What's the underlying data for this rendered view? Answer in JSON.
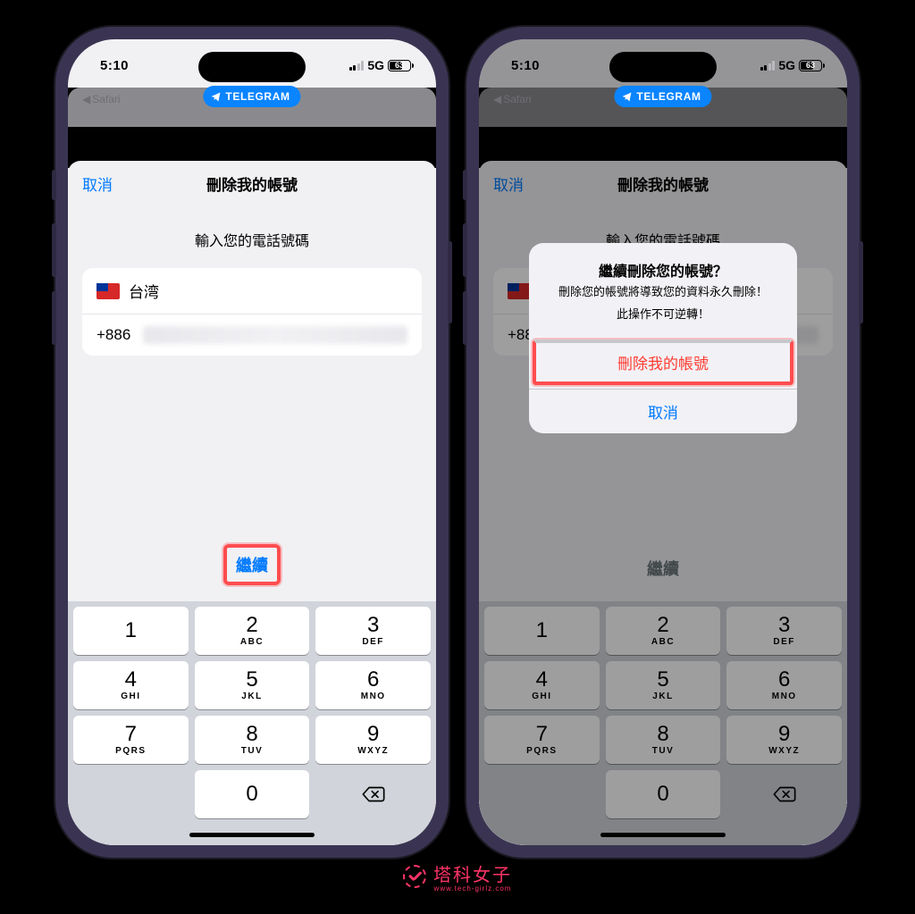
{
  "statusbar": {
    "time": "5:10",
    "back_app": "Safari",
    "pill_label": "TELEGRAM",
    "network": "5G",
    "battery": "63"
  },
  "page": {
    "cancel": "取消",
    "title": "刪除我的帳號",
    "prompt": "輸入您的電話號碼",
    "country": "台湾",
    "dial_code": "+886",
    "continue": "繼續"
  },
  "keypad": {
    "keys": [
      {
        "digit": "1",
        "letters": ""
      },
      {
        "digit": "2",
        "letters": "ABC"
      },
      {
        "digit": "3",
        "letters": "DEF"
      },
      {
        "digit": "4",
        "letters": "GHI"
      },
      {
        "digit": "5",
        "letters": "JKL"
      },
      {
        "digit": "6",
        "letters": "MNO"
      },
      {
        "digit": "7",
        "letters": "PQRS"
      },
      {
        "digit": "8",
        "letters": "TUV"
      },
      {
        "digit": "9",
        "letters": "WXYZ"
      },
      {
        "digit": "",
        "letters": ""
      },
      {
        "digit": "0",
        "letters": ""
      },
      {
        "digit": "⌫",
        "letters": ""
      }
    ]
  },
  "alert": {
    "title": "繼續刪除您的帳號？",
    "message_line1": "刪除您的帳號將導致您的資料永久刪除！",
    "message_line2": "此操作不可逆轉！",
    "destructive": "刪除我的帳號",
    "cancel": "取消"
  },
  "watermark": {
    "brand": "塔科女子",
    "sub": "www.tech-girlz.com"
  }
}
